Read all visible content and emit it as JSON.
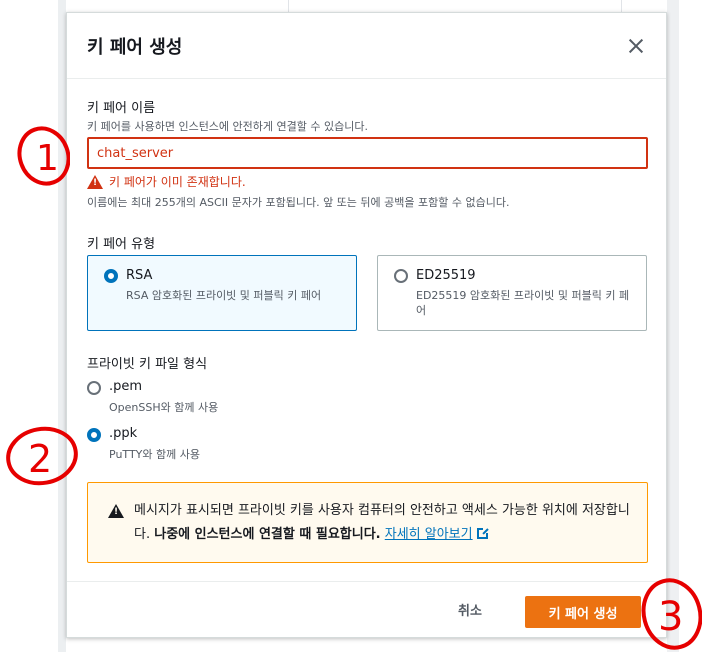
{
  "modal": {
    "title": "키 페어 생성"
  },
  "key_name": {
    "label": "키 페어 이름",
    "description": "키 페어를 사용하면 인스턴스에 안전하게 연결할 수 있습니다.",
    "value": "chat_server",
    "error": "키 페어가 이미 존재합니다.",
    "constraint": "이름에는 최대 255개의 ASCII 문자가 포함됩니다. 앞 또는 뒤에 공백을 포함할 수 없습니다."
  },
  "key_type": {
    "label": "키 페어 유형",
    "options": [
      {
        "title": "RSA",
        "description": "RSA 암호화된 프라이빗 및 퍼블릭 키 페어",
        "selected": true
      },
      {
        "title": "ED25519",
        "description": "ED25519 암호화된 프라이빗 및 퍼블릭 키 페어",
        "selected": false
      }
    ]
  },
  "file_format": {
    "label": "프라이빗 키 파일 형식",
    "options": [
      {
        "title": ".pem",
        "description": "OpenSSH와 함께 사용",
        "selected": false
      },
      {
        "title": ".ppk",
        "description": "PuTTY와 함께 사용",
        "selected": true
      }
    ]
  },
  "alert": {
    "text_plain": "메시지가 표시되면 프라이빗 키를 사용자 컴퓨터의 안전하고 액세스 가능한 위치에 저장합니다. ",
    "text_bold": "나중에 인스턴스에 연결할 때 필요합니다.",
    "link": "자세히 알아보기"
  },
  "footer": {
    "cancel": "취소",
    "create": "키 페어 생성"
  },
  "annotations": [
    "1",
    "2",
    "3"
  ],
  "colors": {
    "accent": "#0073bb",
    "error": "#d13212",
    "primary_button": "#ec7211",
    "annotation": "#e60000"
  }
}
